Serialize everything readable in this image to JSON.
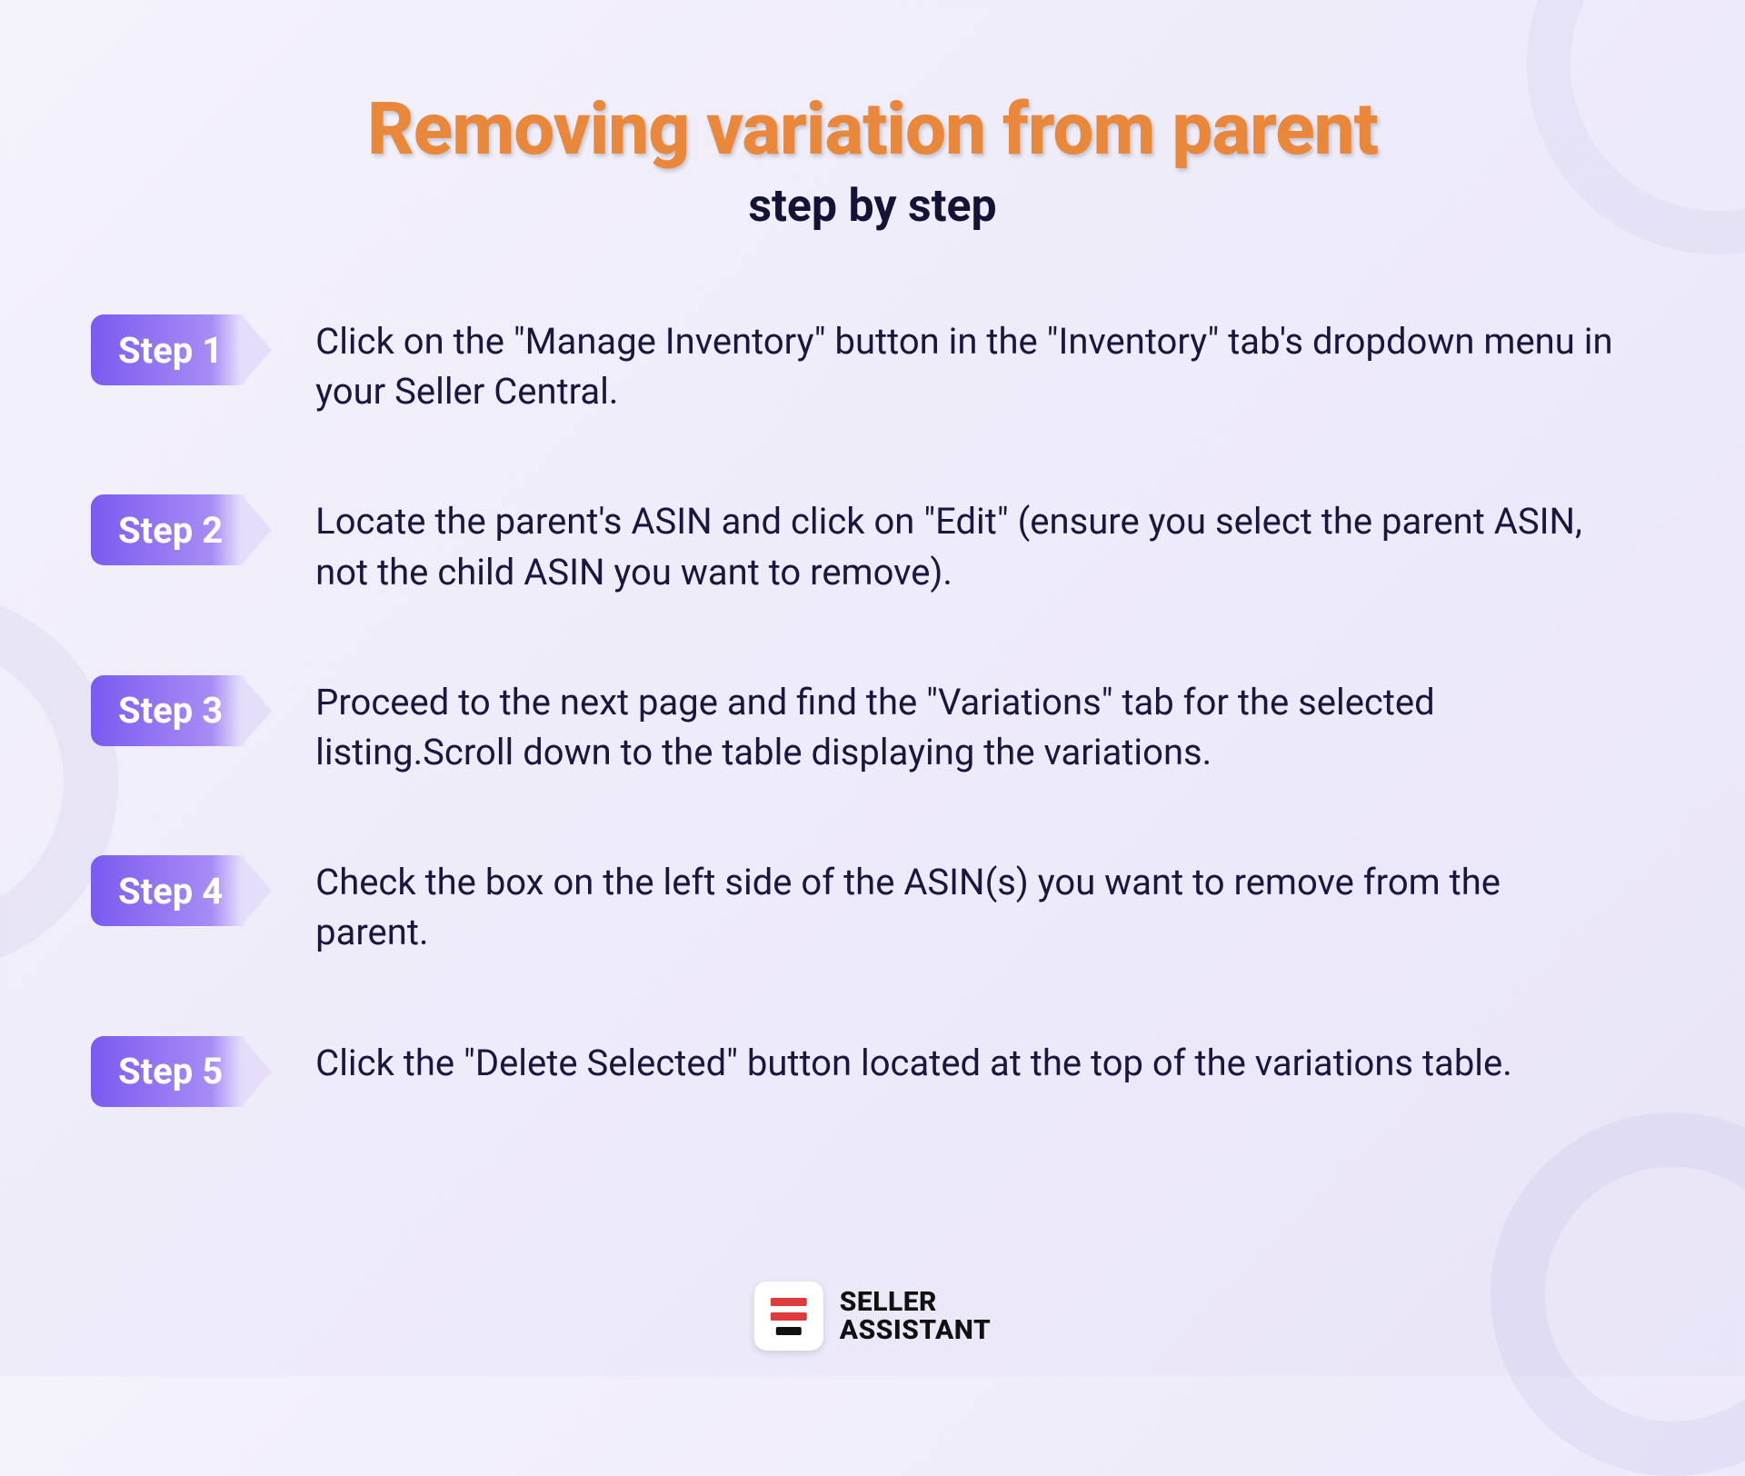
{
  "title": "Removing variation from parent",
  "subtitle": "step by step",
  "steps": [
    {
      "label": "Step 1",
      "text": "Click on the \"Manage Inventory\" button in the \"Inventory\" tab's dropdown menu in your Seller Central."
    },
    {
      "label": "Step 2",
      "text": "Locate the parent's ASIN and click on \"Edit\" (ensure you select the parent ASIN, not the child ASIN you want to remove)."
    },
    {
      "label": "Step 3",
      "text": "Proceed to the next page and find the \"Variations\" tab for the selected listing.Scroll down to the table displaying the variations."
    },
    {
      "label": "Step 4",
      "text": "Check the box on the left side of the ASIN(s) you want to remove from the parent."
    },
    {
      "label": "Step 5",
      "text": "Click the \"Delete Selected\" button located at the top of the variations table."
    }
  ],
  "brand": {
    "line1": "SELLER",
    "line2": "ASSISTANT"
  }
}
